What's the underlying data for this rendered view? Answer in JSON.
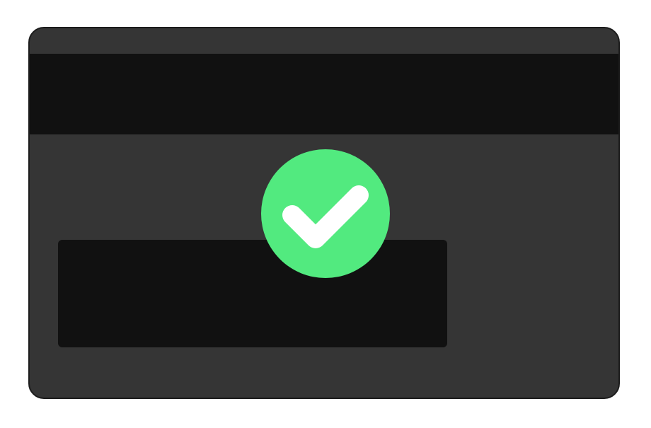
{
  "illustration": {
    "subject": "credit-card-back",
    "status": "verified",
    "icon": "check-icon"
  },
  "colors": {
    "background": "#ffffff",
    "card_body": "#353535",
    "card_border": "#1c1c1c",
    "stripe": "#111111",
    "signature_panel": "#111111",
    "success": "#52ea7f",
    "check_mark": "#ffffff"
  }
}
